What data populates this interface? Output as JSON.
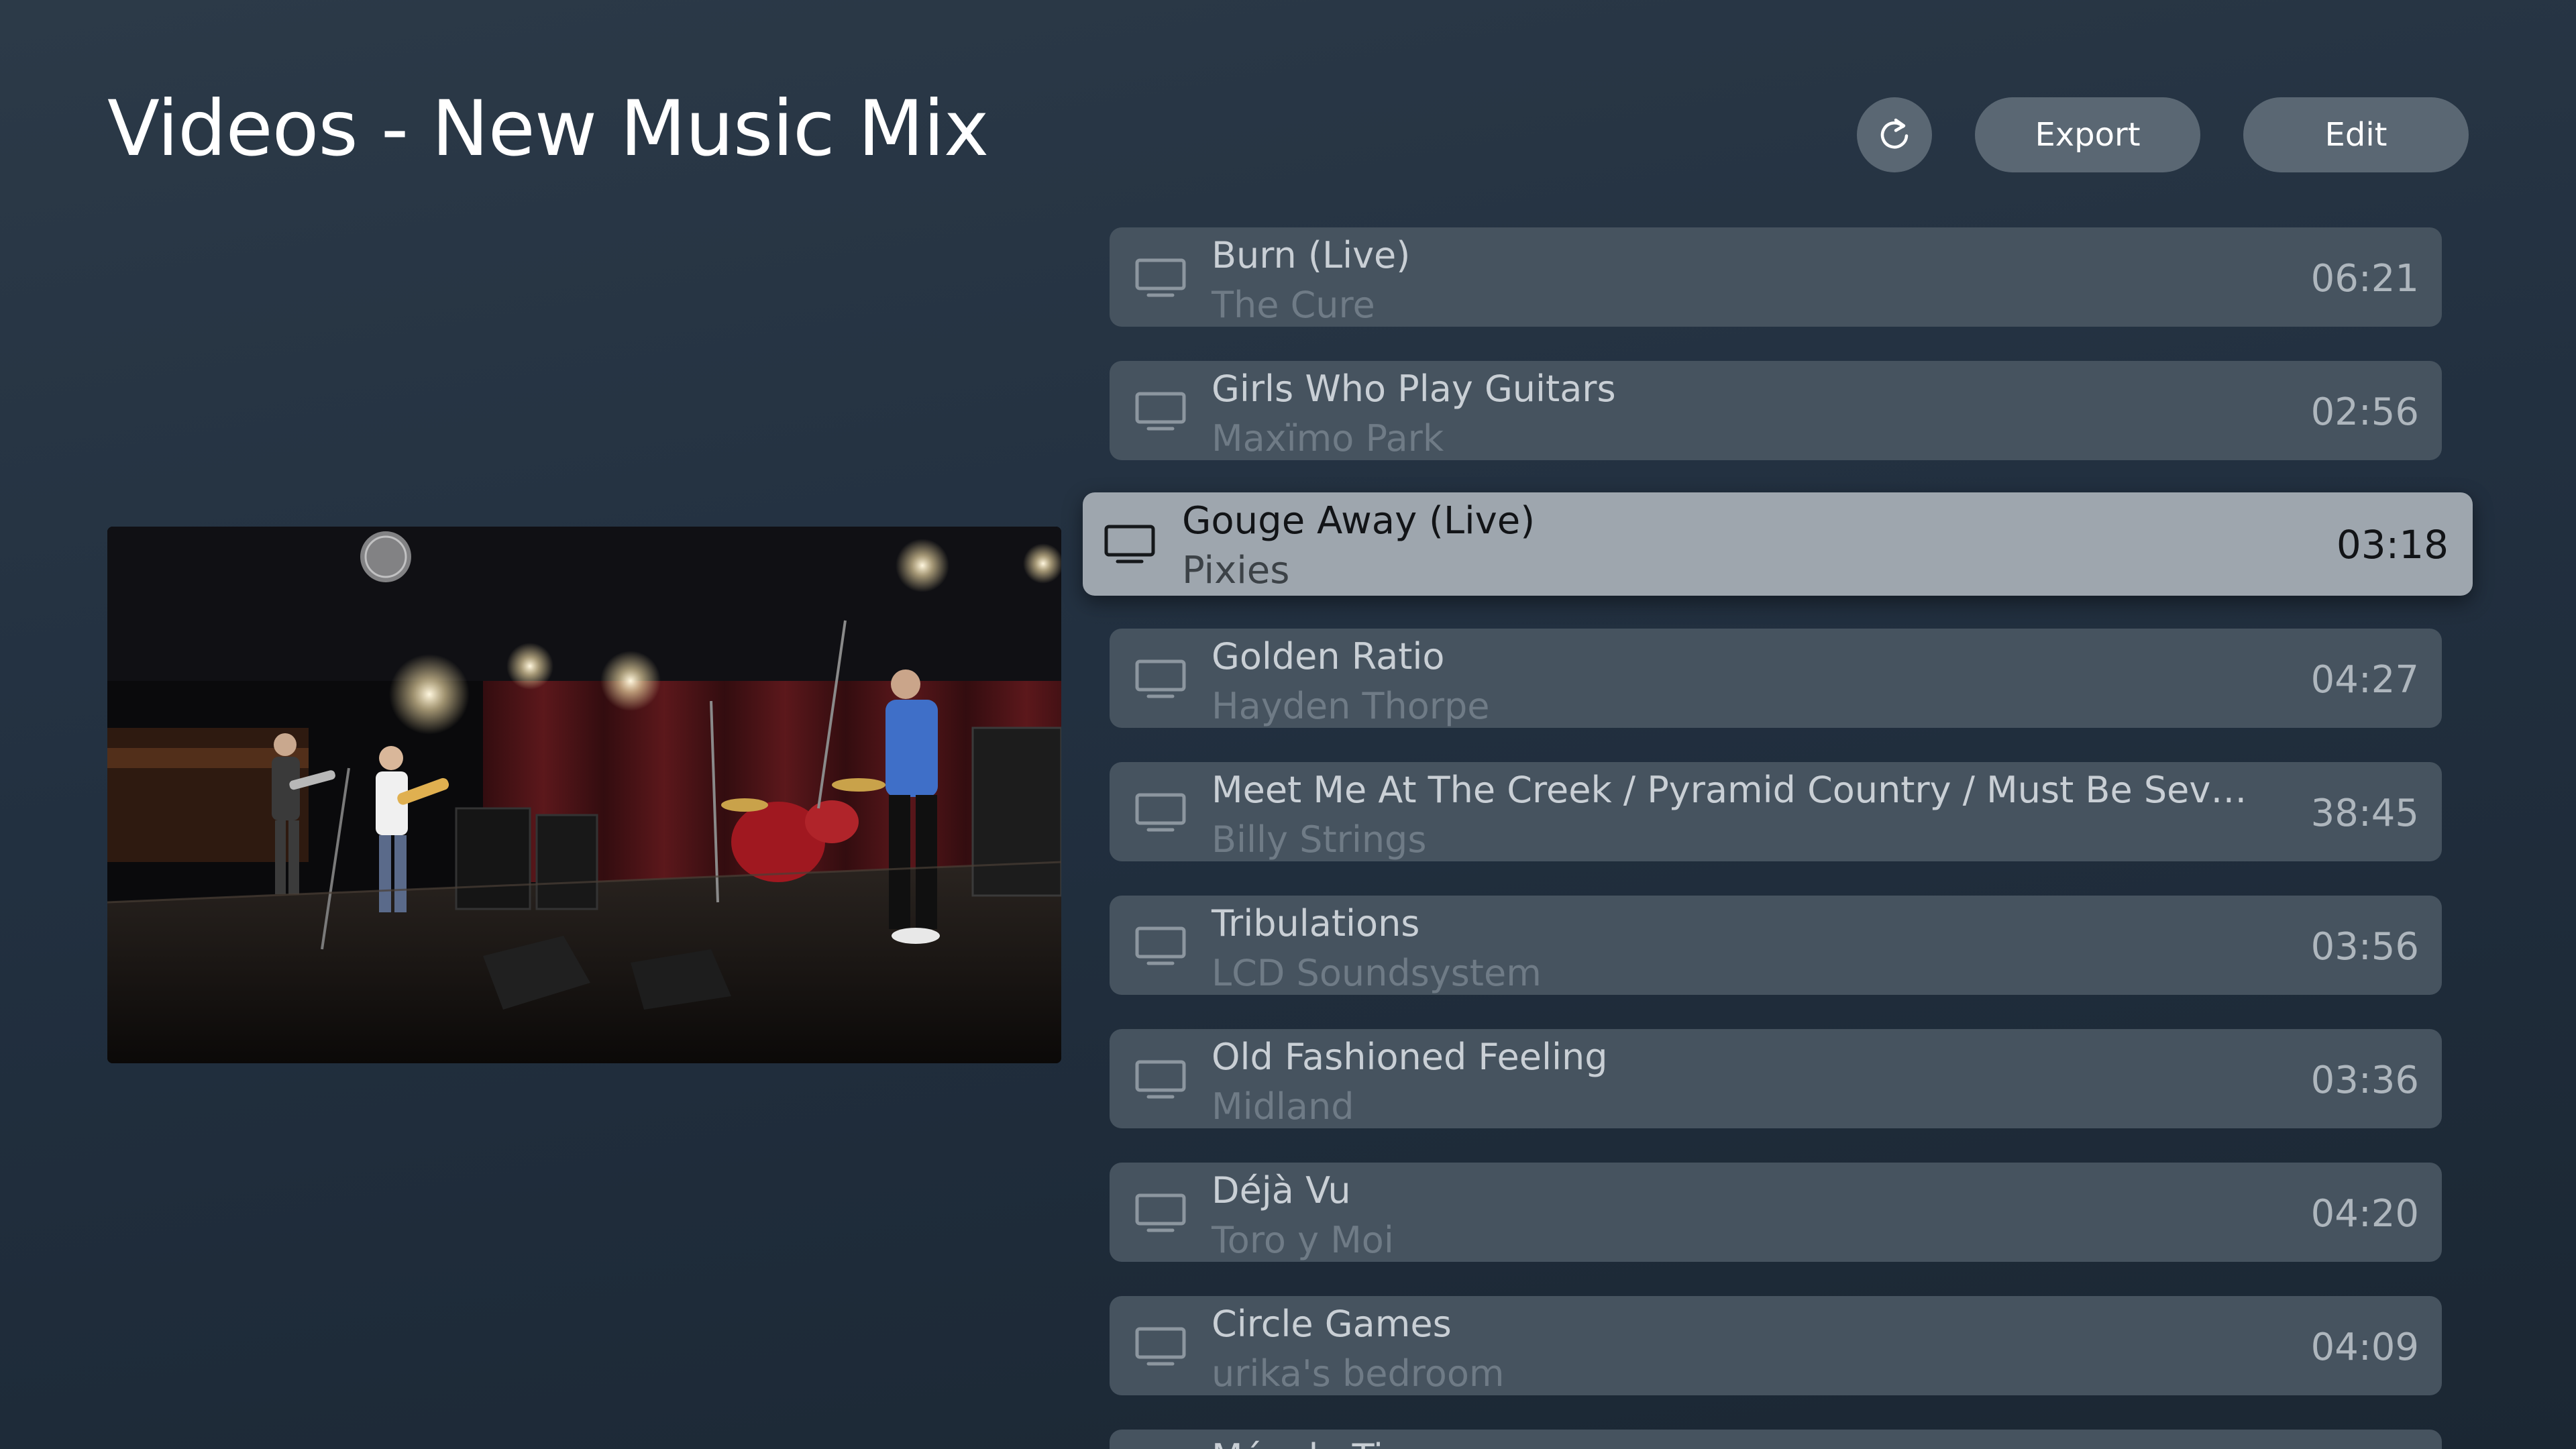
{
  "header": {
    "title": "Videos - New Music Mix",
    "export_label": "Export",
    "edit_label": "Edit",
    "refresh_icon": "refresh-icon"
  },
  "colors": {
    "button_bg": "#5a6773",
    "row_bg": "#46535f",
    "focused_row_bg": "#9ea6ae"
  },
  "videos": [
    {
      "title": "Burn (Live)",
      "artist": "The Cure",
      "duration": "06:21",
      "icon": "tv-icon"
    },
    {
      "title": "Girls Who Play Guitars",
      "artist": "Maxïmo Park",
      "duration": "02:56",
      "icon": "tv-icon"
    },
    {
      "title": "Gouge Away (Live)",
      "artist": "Pixies",
      "duration": "03:18",
      "icon": "tv-icon",
      "focused": true
    },
    {
      "title": "Golden Ratio",
      "artist": "Hayden Thorpe",
      "duration": "04:27",
      "icon": "tv-icon"
    },
    {
      "title": "Meet Me At The Creek / Pyramid Country / Must Be Sev…",
      "artist": "Billy Strings",
      "duration": "38:45",
      "icon": "tv-icon"
    },
    {
      "title": "Tribulations",
      "artist": "LCD Soundsystem",
      "duration": "03:56",
      "icon": "tv-icon"
    },
    {
      "title": "Old Fashioned Feeling",
      "artist": "Midland",
      "duration": "03:36",
      "icon": "tv-icon"
    },
    {
      "title": "Déjà Vu",
      "artist": "Toro y Moi",
      "duration": "04:20",
      "icon": "tv-icon"
    },
    {
      "title": "Circle Games",
      "artist": "urika's bedroom",
      "duration": "04:09",
      "icon": "tv-icon"
    },
    {
      "title": "Más de Ti",
      "artist": "",
      "duration": "",
      "icon": "tv-icon"
    }
  ]
}
